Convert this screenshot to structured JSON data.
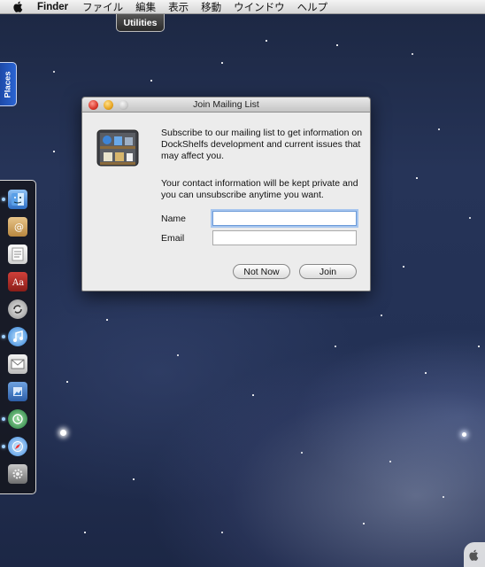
{
  "menubar": {
    "app_name": "Finder",
    "items": [
      "ファイル",
      "編集",
      "表示",
      "移動",
      "ウインドウ",
      "ヘルプ"
    ]
  },
  "utilities_tab": {
    "label": "Utilities"
  },
  "places_tab": {
    "label": "Places"
  },
  "dock": {
    "icons": [
      {
        "name": "finder-icon",
        "active": true
      },
      {
        "name": "address-book-icon",
        "active": false
      },
      {
        "name": "textedit-icon",
        "active": false
      },
      {
        "name": "dictionary-icon",
        "active": false
      },
      {
        "name": "sync-icon",
        "active": false
      },
      {
        "name": "itunes-icon",
        "active": true
      },
      {
        "name": "mail-icon",
        "active": false
      },
      {
        "name": "preview-icon",
        "active": false
      },
      {
        "name": "time-machine-icon",
        "active": true
      },
      {
        "name": "safari-icon",
        "active": true
      },
      {
        "name": "system-preferences-icon",
        "active": false
      }
    ]
  },
  "dialog": {
    "title": "Join Mailing List",
    "paragraph1": "Subscribe to our mailing list to get information on DockShelfs development and current issues that may affect you.",
    "paragraph2": "Your contact information will be kept private and you can unsubscribe anytime you want.",
    "name_label": "Name",
    "name_value": "",
    "email_label": "Email",
    "email_value": "",
    "not_now_label": "Not Now",
    "join_label": "Join"
  }
}
